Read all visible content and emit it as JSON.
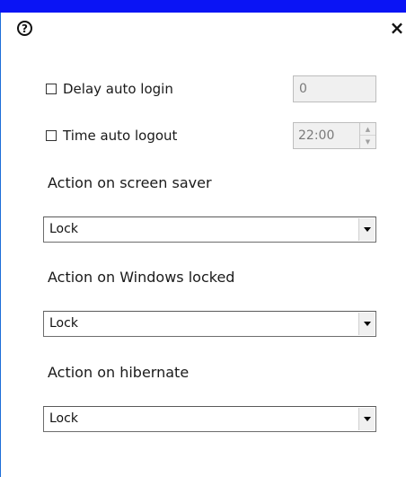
{
  "dialog": {
    "help_icon_glyph": "?",
    "close_icon_glyph": "×",
    "accent_color": "#0a14f5"
  },
  "delay_auto_login": {
    "label": "Delay auto login",
    "checked": false,
    "value": "0"
  },
  "time_auto_logout": {
    "label": "Time auto logout",
    "checked": false,
    "value": "22:00"
  },
  "screen_saver": {
    "label": "Action on screen saver",
    "value": "Lock"
  },
  "windows_locked": {
    "label": "Action on Windows locked",
    "value": "Lock"
  },
  "hibernate": {
    "label": "Action on hibernate",
    "value": "Lock"
  }
}
